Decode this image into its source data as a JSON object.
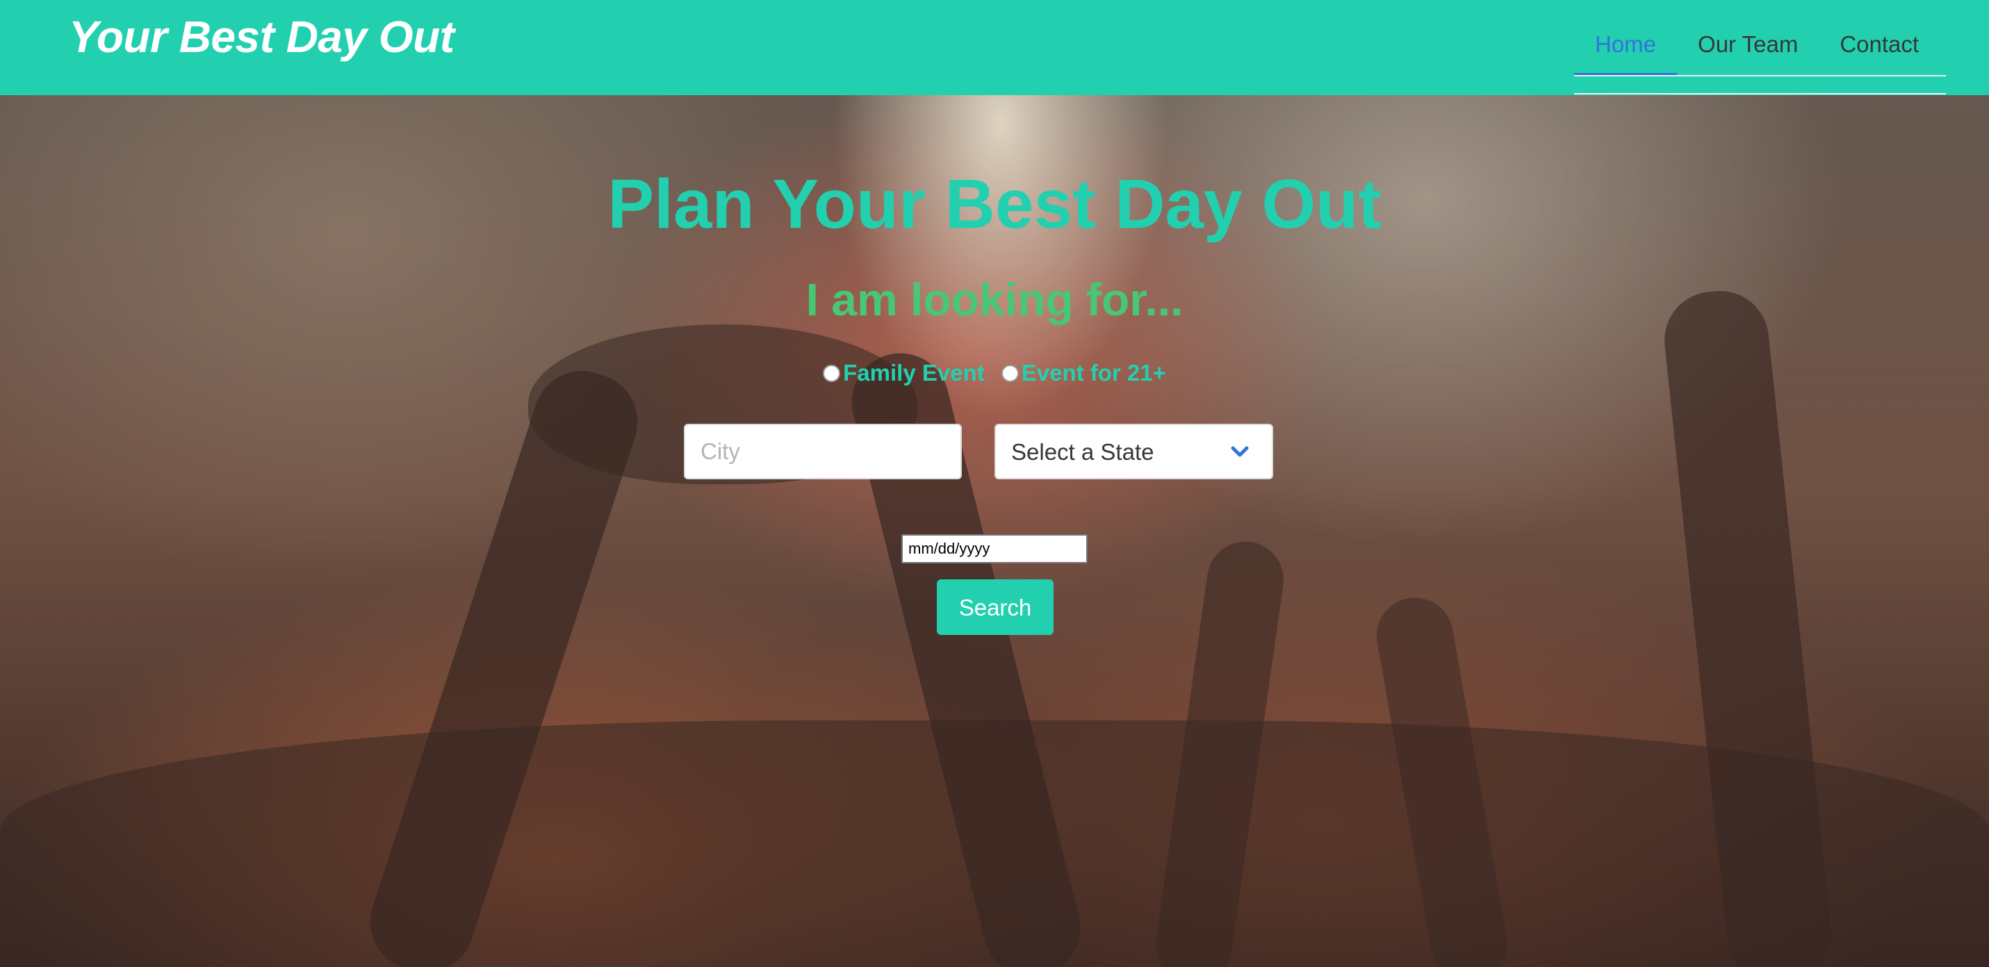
{
  "navbar": {
    "brand": "Your Best Day Out",
    "tabs": [
      {
        "label": "Home",
        "active": true
      },
      {
        "label": "Our Team",
        "active": false
      },
      {
        "label": "Contact",
        "active": false
      }
    ]
  },
  "hero": {
    "title": "Plan Your Best Day Out",
    "subtitle": "I am looking for...",
    "event_types": [
      {
        "label": "Family Event",
        "selected": false
      },
      {
        "label": "Event for 21+",
        "selected": false
      }
    ],
    "city": {
      "placeholder": "City",
      "value": ""
    },
    "state": {
      "selected": "Select a State",
      "icon": "chevron-down-icon"
    },
    "date": {
      "value": "mm/dd/yyyy"
    },
    "search_label": "Search"
  },
  "colors": {
    "primary": "#22d0b0",
    "subtitle": "#48c774",
    "link_active": "#3273dc",
    "nav_text": "#363636"
  }
}
